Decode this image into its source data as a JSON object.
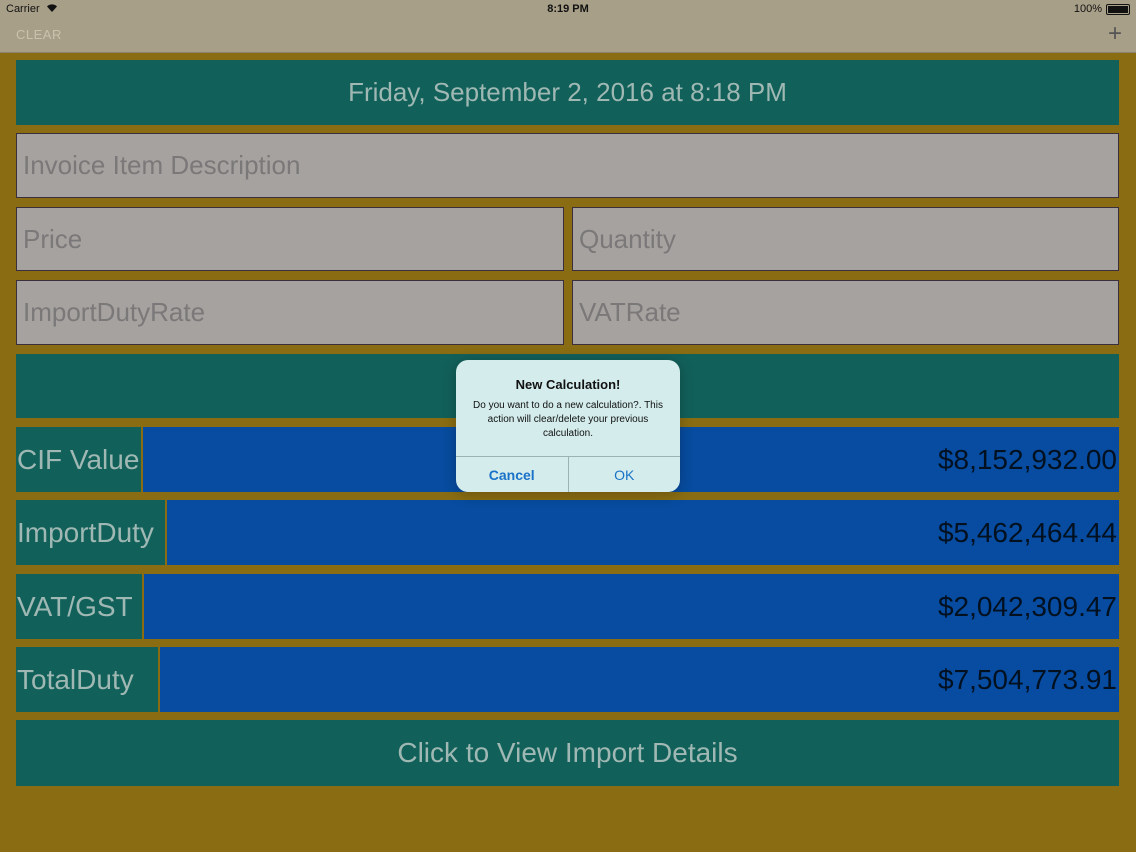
{
  "status_bar": {
    "carrier": "Carrier",
    "time": "8:19 PM",
    "battery": "100%"
  },
  "nav": {
    "clear_label": "CLEAR",
    "add_icon": "plus-icon"
  },
  "form": {
    "date": "Friday, September 2, 2016 at 8:18 PM",
    "description_placeholder": "Invoice Item Description",
    "price_placeholder": "Price",
    "quantity_placeholder": "Quantity",
    "import_duty_rate_placeholder": "ImportDutyRate",
    "vat_rate_placeholder": "VATRate"
  },
  "results": [
    {
      "label": "CIF Value",
      "value": "$8,152,932.00"
    },
    {
      "label": "ImportDuty",
      "value": "$5,462,464.44"
    },
    {
      "label": "VAT/GST",
      "value": "$2,042,309.47"
    },
    {
      "label": "TotalDuty",
      "value": "$7,504,773.91"
    }
  ],
  "view_details_label": "Click to View Import Details",
  "alert": {
    "title": "New Calculation!",
    "message": "Do you want to do a new calculation?. This action will clear/delete your previous calculation.",
    "cancel_label": "Cancel",
    "ok_label": "OK"
  },
  "colors": {
    "background": "#8a6d12",
    "teal": "#12605a",
    "blue": "#074ca0",
    "field": "#a6a2a0"
  }
}
